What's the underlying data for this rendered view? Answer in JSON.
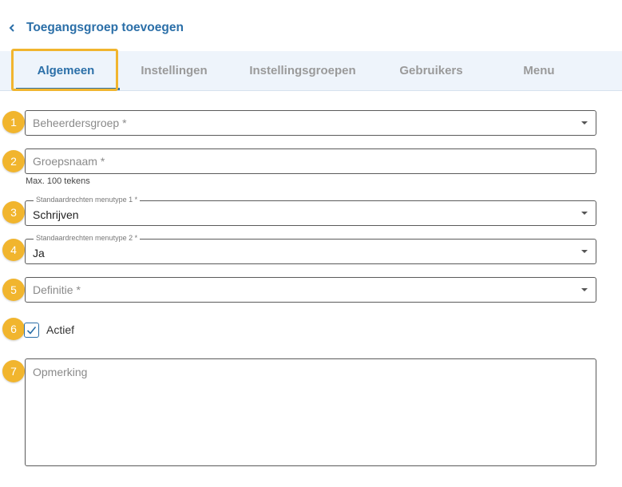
{
  "header": {
    "back_icon": "chevron-left-icon",
    "title": "Toegangsgroep toevoegen"
  },
  "tabs": [
    {
      "label": "Algemeen",
      "active": true
    },
    {
      "label": "Instellingen",
      "active": false
    },
    {
      "label": "Instellingsgroepen",
      "active": false
    },
    {
      "label": "Gebruikers",
      "active": false
    },
    {
      "label": "Menu",
      "active": false
    }
  ],
  "colors": {
    "accent": "#2b6fa8",
    "highlight": "#f1b52e",
    "tabbar_bg": "#eef4fb"
  },
  "form": {
    "beheerdersgroep": {
      "badge": "1",
      "placeholder": "Beheerdersgroep *"
    },
    "groepsnaam": {
      "badge": "2",
      "placeholder": "Groepsnaam *",
      "hint": "Max. 100 tekens"
    },
    "menutype1": {
      "badge": "3",
      "label": "Standaardrechten menutype 1 *",
      "value": "Schrijven"
    },
    "menutype2": {
      "badge": "4",
      "label": "Standaardrechten menutype 2 *",
      "value": "Ja"
    },
    "definitie": {
      "badge": "5",
      "placeholder": "Definitie *"
    },
    "actief": {
      "badge": "6",
      "label": "Actief",
      "checked": true
    },
    "opmerking": {
      "badge": "7",
      "placeholder": "Opmerking"
    }
  }
}
